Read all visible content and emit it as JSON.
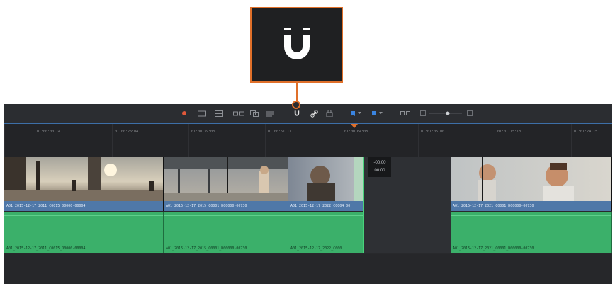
{
  "callout": {
    "icon": "magnet-snapping-icon",
    "accent": "#e0702a"
  },
  "toolbar": {
    "icons": [
      "flag-icon",
      "camera-icon",
      "insert-icon",
      "overwrite-icon",
      "replace-icon",
      "fit-to-fill-icon",
      "snapping-icon",
      "link-icon",
      "lock-icon",
      "marker-color-icon",
      "marker-dropdown-icon",
      "marker-blue-icon",
      "marker-blue-dropdown-icon",
      "zoom-detail-icon",
      "zoom-slider",
      "zoom-max-icon"
    ]
  },
  "ruler": {
    "timecodes": [
      "01:00:00:14",
      "01:00:26:04",
      "01:00:39:03",
      "01:00:51:13",
      "01:00:64:08",
      "01:01:05:00",
      "01:01:15:13",
      "01:01:24:15"
    ]
  },
  "tooltip": {
    "line1": "-00:00",
    "line2": "00:00"
  },
  "video_clips": [
    {
      "label": "A01_2015-12-17_2011_C0015_D0000-00004"
    },
    {
      "label": "A01_2015-12-17_2015_C0001_D00000-00730"
    },
    {
      "label": "A01_2015-12-17_2022_C0004_D0"
    },
    {
      "label": "A01_2015-12-17_2021_C0001_D00000-00730"
    }
  ],
  "audio_clips": [
    {
      "label": "A01_2015-12-17_2011_C0015_D0000-00004"
    },
    {
      "label": "A01_2015-12-17_2015_C0001_D00000-00730"
    },
    {
      "label": "A01_2015-12-17_2022_C000"
    },
    {
      "label": "A01_2015-12-17_2021_C0001_D00000-00730"
    }
  ],
  "colors": {
    "video_bar": "#4f78a8",
    "audio": "#3bb06a",
    "panel": "#28292c"
  }
}
